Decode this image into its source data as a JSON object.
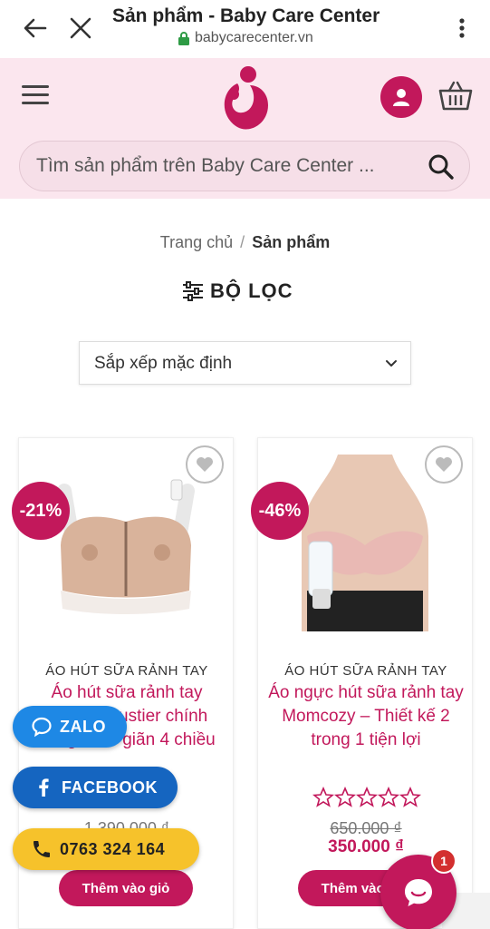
{
  "browser": {
    "tab_title": "Sản phẩm - Baby Care Center",
    "url": "babycarecenter.vn"
  },
  "header": {
    "search_placeholder": "Tìm sản phẩm trên Baby Care Center ..."
  },
  "breadcrumb": {
    "home": "Trang chủ",
    "separator": "/",
    "current": "Sản phẩm"
  },
  "filter": {
    "label": "BỘ LỌC"
  },
  "sort": {
    "selected": "Sắp xếp mặc định"
  },
  "products": [
    {
      "sale_badge": "-21%",
      "category": "ÁO HÚT SỮA RẢNH TAY",
      "name": "Áo hút sữa rảnh tay Medela Bustier chính hãng – Co giãn 4 chiều",
      "old_price": "1.390.000 ₫",
      "new_price": "",
      "add_to_cart": "Thêm vào giỏ",
      "rating": 0
    },
    {
      "sale_badge": "-46%",
      "category": "ÁO HÚT SỮA RẢNH TAY",
      "name": "Áo ngực hút sữa rảnh tay Momcozy – Thiết kế 2 trong 1 tiện lợi",
      "old_price": "650.000 ₫",
      "new_price": "350.000 ₫",
      "add_to_cart": "Thêm vào giỏ",
      "rating": 0
    }
  ],
  "contact": {
    "zalo": "ZALO",
    "facebook": "FACEBOOK",
    "phone": "0763 324 164"
  },
  "chat": {
    "unread_count": "1"
  },
  "colors": {
    "brand": "#c2185b",
    "header_bg": "#fbe6ee",
    "zalo": "#1e88e5",
    "facebook": "#1565c0",
    "phone": "#f6c22b"
  }
}
